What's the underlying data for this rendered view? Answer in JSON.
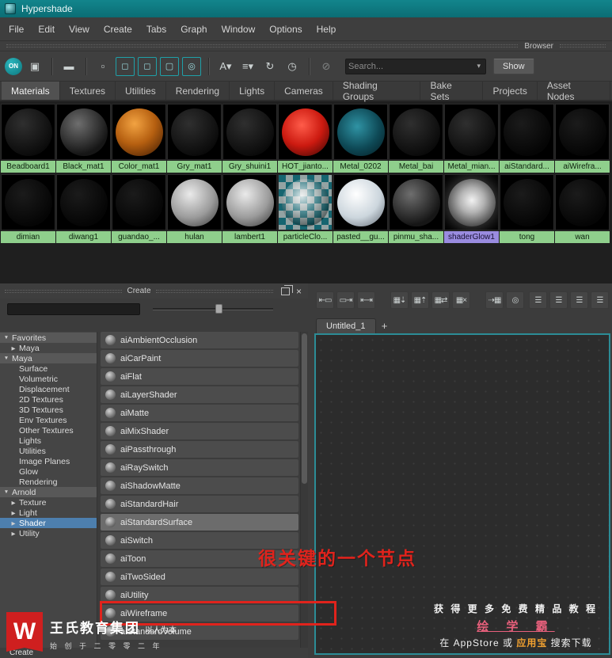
{
  "window": {
    "title": "Hypershade"
  },
  "menubar": {
    "items": [
      "File",
      "Edit",
      "View",
      "Create",
      "Tabs",
      "Graph",
      "Window",
      "Options",
      "Help"
    ]
  },
  "browser_panel": {
    "label": "Browser"
  },
  "toolbar": {
    "icons": [
      {
        "name": "swatch-on-toggle-icon",
        "glyph": "ON",
        "kind": "on"
      },
      {
        "name": "render-view-icon",
        "glyph": "▣",
        "kind": "btn"
      },
      {
        "kind": "sep"
      },
      {
        "name": "single-row-icon",
        "glyph": "▬",
        "kind": "btn"
      },
      {
        "kind": "sep"
      },
      {
        "name": "extra-small-swatch-icon",
        "glyph": "▫",
        "kind": "btn"
      },
      {
        "name": "small-swatch-icon",
        "glyph": "◻",
        "kind": "btn-teal"
      },
      {
        "name": "medium-swatch-icon",
        "glyph": "◻",
        "kind": "btn-teal"
      },
      {
        "name": "large-swatch-icon",
        "glyph": "▢",
        "kind": "btn-teal"
      },
      {
        "name": "sphere-swatch-icon",
        "glyph": "◎",
        "kind": "btn-teal"
      },
      {
        "kind": "sep"
      },
      {
        "name": "sort-alphabetical-icon",
        "glyph": "A▾",
        "kind": "btn"
      },
      {
        "name": "sort-by-type-icon",
        "glyph": "≡▾",
        "kind": "btn"
      },
      {
        "name": "refresh-swatches-icon",
        "glyph": "↻",
        "kind": "btn"
      },
      {
        "name": "auto-update-icon",
        "glyph": "◷",
        "kind": "btn"
      },
      {
        "kind": "sep"
      },
      {
        "name": "filter-off-icon",
        "glyph": "⊘",
        "kind": "btn-dim"
      }
    ],
    "search": {
      "placeholder": "Search..."
    },
    "show_button": "Show"
  },
  "category_tabs": {
    "active": "Materials",
    "items": [
      "Materials",
      "Textures",
      "Utilities",
      "Rendering",
      "Lights",
      "Cameras",
      "Shading Groups",
      "Bake Sets",
      "Projects",
      "Asset Nodes"
    ]
  },
  "materials": {
    "label_color": "#8fcf8c",
    "selected_label_color": "#9a8ce0",
    "rows": [
      [
        {
          "name": "Beadboard1",
          "sphere": "faint"
        },
        {
          "name": "Black_mat1",
          "sphere": "darkgray"
        },
        {
          "name": "Color_mat1",
          "sphere": "orange"
        },
        {
          "name": "Gry_mat1",
          "sphere": "faint"
        },
        {
          "name": "Gry_shuini1",
          "sphere": "faint"
        },
        {
          "name": "HOT_jianto...",
          "sphere": "red"
        },
        {
          "name": "Metal_0202",
          "sphere": "teal"
        },
        {
          "name": "Metal_bai",
          "sphere": "faint"
        },
        {
          "name": "Metal_mian...",
          "sphere": "faint"
        },
        {
          "name": "aiStandard...",
          "sphere": "black"
        },
        {
          "name": "aiWirefra...",
          "sphere": "black"
        }
      ],
      [
        {
          "name": "dimian",
          "sphere": "black"
        },
        {
          "name": "diwang1",
          "sphere": "black"
        },
        {
          "name": "guandao_...",
          "sphere": "black"
        },
        {
          "name": "hulan",
          "sphere": "lightgray"
        },
        {
          "name": "lambert1",
          "sphere": "lightgray"
        },
        {
          "name": "particleClo...",
          "sphere": "checker"
        },
        {
          "name": "pasted__gu...",
          "sphere": "white"
        },
        {
          "name": "pinmu_sha...",
          "sphere": "darkgray"
        },
        {
          "name": "shaderGlow1",
          "sphere": "glow",
          "selected": true
        },
        {
          "name": "tong",
          "sphere": "black"
        },
        {
          "name": "wan",
          "sphere": "black"
        }
      ]
    ]
  },
  "create_panel": {
    "title": "Create",
    "tree": [
      {
        "label": "Favorites",
        "level": 0,
        "arrow": "down",
        "header": true
      },
      {
        "label": "Maya",
        "level": 1,
        "arrow": "right"
      },
      {
        "label": "Maya",
        "level": 0,
        "arrow": "down",
        "header": true
      },
      {
        "label": "Surface",
        "level": 1
      },
      {
        "label": "Volumetric",
        "level": 1
      },
      {
        "label": "Displacement",
        "level": 1
      },
      {
        "label": "2D Textures",
        "level": 1
      },
      {
        "label": "3D Textures",
        "level": 1
      },
      {
        "label": "Env Textures",
        "level": 1
      },
      {
        "label": "Other Textures",
        "level": 1
      },
      {
        "label": "Lights",
        "level": 1
      },
      {
        "label": "Utilities",
        "level": 1
      },
      {
        "label": "Image Planes",
        "level": 1
      },
      {
        "label": "Glow",
        "level": 1
      },
      {
        "label": "Rendering",
        "level": 1
      },
      {
        "label": "Arnold",
        "level": 0,
        "arrow": "down",
        "header": true
      },
      {
        "label": "Texture",
        "level": 1,
        "arrow": "right"
      },
      {
        "label": "Light",
        "level": 1,
        "arrow": "right"
      },
      {
        "label": "Shader",
        "level": 1,
        "arrow": "right",
        "selected": true
      },
      {
        "label": "Utility",
        "level": 1,
        "arrow": "right"
      }
    ],
    "nodes": [
      {
        "label": "aiAmbientOcclusion"
      },
      {
        "label": "aiCarPaint"
      },
      {
        "label": "aiFlat"
      },
      {
        "label": "aiLayerShader"
      },
      {
        "label": "aiMatte"
      },
      {
        "label": "aiMixShader"
      },
      {
        "label": "aiPassthrough"
      },
      {
        "label": "aiRaySwitch"
      },
      {
        "label": "aiShadowMatte"
      },
      {
        "label": "aiStandardHair"
      },
      {
        "label": "aiStandardSurface",
        "selected": true
      },
      {
        "label": "aiSwitch"
      },
      {
        "label": "aiToon"
      },
      {
        "label": "aiTwoSided"
      },
      {
        "label": "aiUtility"
      },
      {
        "label": "aiWireframe",
        "annotated": true
      },
      {
        "label": "aiStandardVolume"
      }
    ],
    "bottom_tab": "Create"
  },
  "work_area": {
    "icons": [
      {
        "name": "show-input-connections-icon",
        "glyph": "⇤▭"
      },
      {
        "name": "show-output-connections-icon",
        "glyph": "▭⇥"
      },
      {
        "name": "show-all-connections-icon",
        "glyph": "⇤⇥"
      },
      {
        "gap": true
      },
      {
        "name": "add-to-graph-icon",
        "glyph": "▦⇣"
      },
      {
        "name": "remove-from-graph-icon",
        "glyph": "▦⇡"
      },
      {
        "name": "graph-selected-icon",
        "glyph": "▦⇄"
      },
      {
        "name": "clear-graph-icon",
        "glyph": "▦×"
      },
      {
        "gap": true
      },
      {
        "name": "rearrange-graph-icon",
        "glyph": "⇢▦"
      },
      {
        "name": "frame-all-icon",
        "glyph": "◎"
      },
      {
        "push": true
      },
      {
        "name": "layout-full-icon",
        "glyph": "☰"
      },
      {
        "name": "layout-horizontal-icon",
        "glyph": "☰"
      },
      {
        "name": "layout-vertical-icon",
        "glyph": "☰"
      },
      {
        "name": "layout-quad-icon",
        "glyph": "☰"
      }
    ],
    "tab_label": "Untitled_1",
    "new_tab_label": "+"
  },
  "annotation": {
    "text": "很关键的一个节点",
    "color": "#e0231c"
  },
  "watermark_left": {
    "logo_letter": "W",
    "company": "王氏教育集团",
    "slogan": "以人为本",
    "founded": "始 创 于 二 零 零 二 年"
  },
  "watermark_right": {
    "line1": "获 得 更 多 免 费 精 品 教 程",
    "line2": "绘 学 霸",
    "line3_prefix": "在 AppStore 或 ",
    "line3_highlight": "应用宝",
    "line3_suffix": " 搜索下载"
  }
}
